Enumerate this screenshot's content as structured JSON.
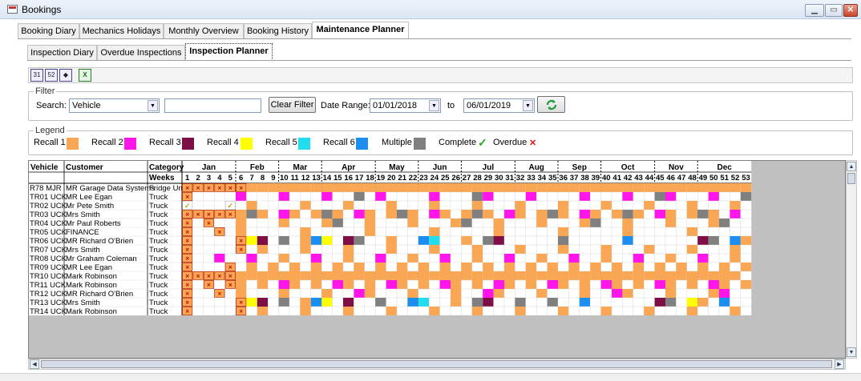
{
  "window": {
    "title": "Bookings",
    "icon": "app-window-icon"
  },
  "main_tabs": [
    {
      "label": "Booking Diary",
      "active": false
    },
    {
      "label": "Mechanics Holidays",
      "active": false
    },
    {
      "label": "Monthly Overview",
      "active": false
    },
    {
      "label": "Booking History",
      "active": false
    },
    {
      "label": "Maintenance Planner",
      "active": true
    }
  ],
  "sub_tabs": [
    {
      "label": "Inspection Diary",
      "active": false
    },
    {
      "label": "Overdue Inspections",
      "active": false
    },
    {
      "label": "Inspection Planner",
      "active": true
    }
  ],
  "toolbar": {
    "buttons": [
      {
        "label": "31",
        "icon": "day-view-icon"
      },
      {
        "label": "52",
        "icon": "week-view-icon"
      },
      {
        "label": "◆",
        "icon": "expand-icon"
      },
      {
        "label": "X",
        "icon": "excel-export-icon"
      }
    ]
  },
  "filter": {
    "group_label": "Filter",
    "search_label": "Search:",
    "search_select": "Vehicle",
    "search_text": "",
    "clear_button": "Clear Filter",
    "date_range_label": "Date Range:",
    "date_from": "01/01/2018",
    "to_label": "to",
    "date_to": "06/01/2019",
    "refresh_icon": "refresh-icon"
  },
  "legend": {
    "group_label": "Legend",
    "items": [
      {
        "label": "Recall 1",
        "color": "#f9a655"
      },
      {
        "label": "Recall 2",
        "color": "#ff14ea"
      },
      {
        "label": "Recall 3",
        "color": "#7e0f46"
      },
      {
        "label": "Recall 4",
        "color": "#ffff00"
      },
      {
        "label": "Recall 5",
        "color": "#22dcf0"
      },
      {
        "label": "Recall 6",
        "color": "#1c8ef0"
      },
      {
        "label": "Multiple",
        "color": "#808080"
      },
      {
        "label": "Complete",
        "icon": "check-icon",
        "color": "#2aa52a"
      },
      {
        "label": "Overdue",
        "icon": "cross-icon",
        "color": "#e01515"
      }
    ]
  },
  "planner": {
    "headers": {
      "vehicle": "Vehicle",
      "customer": "Customer",
      "category": "Category",
      "weeks": "Weeks"
    },
    "months": [
      {
        "label": "Jan",
        "weeks": 5
      },
      {
        "label": "Feb",
        "weeks": 4
      },
      {
        "label": "Mar",
        "weeks": 4
      },
      {
        "label": "Apr",
        "weeks": 5
      },
      {
        "label": "May",
        "weeks": 4
      },
      {
        "label": "Jun",
        "weeks": 4
      },
      {
        "label": "Jul",
        "weeks": 5
      },
      {
        "label": "Aug",
        "weeks": 4
      },
      {
        "label": "Sep",
        "weeks": 4
      },
      {
        "label": "Oct",
        "weeks": 5
      },
      {
        "label": "Nov",
        "weeks": 4
      },
      {
        "label": "Dec",
        "weeks": 5
      }
    ],
    "week_numbers": [
      "1",
      "2",
      "3",
      "4",
      "5",
      "6",
      "7",
      "8",
      "9",
      "10",
      "11",
      "12",
      "13",
      "14",
      "15",
      "16",
      "17",
      "18",
      "19",
      "20",
      "21",
      "22",
      "23",
      "24",
      "25",
      "26",
      "27",
      "28",
      "29",
      "30",
      "31",
      "32",
      "33",
      "34",
      "35",
      "36",
      "37",
      "38",
      "39",
      "40",
      "41",
      "42",
      "43",
      "44",
      "45",
      "46",
      "47",
      "48",
      "49",
      "50",
      "51",
      "52",
      "53"
    ],
    "rows": [
      {
        "vehicle": "R78 MJR",
        "customer": "MR Garage Data Systems",
        "category": "Fridge Unit",
        "cells": "XXXXXX11111111111111111111111111111111111111111111111"
      },
      {
        "vehicle": "TR01 UCK",
        "customer": "MR Lee Egan",
        "category": "Truck",
        "cells": "X....2...2...2..G.2....2...G2...2....2...2..G2...2..G"
      },
      {
        "vehicle": "TR02 UCK",
        "customer": "Mr Pete Smith",
        "category": "Truck",
        "cells": "C...C.1....1...1...1...1...1...1...1...1...1...1...1"
      },
      {
        "vehicle": "TR03 UCK",
        "customer": "Mrs Smith",
        "category": "Truck",
        "cells": "XXXXX1G1.21.1G1.21.1G1.21.1G1.21.1G1.21.1G1.21.1G1.2"
      },
      {
        "vehicle": "TR04 UCK",
        "customer": "Mr Paul Roberts",
        "category": "Truck",
        "cells": "X.X..1...1...1G..1...1...1G..1...1...1G..1...1...1G.."
      },
      {
        "vehicle": "TR05 UCK",
        "customer": "FINANCE",
        "category": "Truck",
        "cells": "X..X.1.....1.....1.....1.....1.....1.....1.....1...."
      },
      {
        "vehicle": "TR06 UCK",
        "customer": "MR Richard O'Brien",
        "category": "Truck",
        "cells": "X....XYM.G.1BY.MG..1..B6..1.G3.....G.....B......3G.B1"
      },
      {
        "vehicle": "TR07 UCK",
        "customer": "Mrs Smith",
        "category": "Truck",
        "cells": "X....X.1...1...1...1...1...1...1...1...1...1...1...1."
      },
      {
        "vehicle": "TR08 UCK",
        "customer": "Mr Graham Coleman",
        "category": "Truck",
        "cells": "X..2..2..1..2..1..2..1..2..1..2..1..2..1..2..1..2..1."
      },
      {
        "vehicle": "TR09 UCK",
        "customer": "MR Lee Egan",
        "category": "Truck",
        "cells": "X...X.1.1.1.1.1.1.1.1.1.1.1.1.1.1.1.1.1.1.1.1.1.1.1.1"
      },
      {
        "vehicle": "TR10 UCK",
        "customer": "Mark Robinson",
        "category": "Truck",
        "cells": "XXXXX11111111111111111111111111111111111111111111111"
      },
      {
        "vehicle": "TR11 UCK",
        "customer": "Mark Robinson",
        "category": "Truck",
        "cells": "X.X.X1.1.21.1.21.1.21.1.21.1.21.1.21.1.21.1.21.1.21.1"
      },
      {
        "vehicle": "TR12 UCK",
        "customer": "MR Richard O'Brien",
        "category": "Truck",
        "cells": "X..X.1...1...1..21...1...1..21...1...1..21...1...12.."
      },
      {
        "vehicle": "TR13 UCK",
        "customer": "Mrs Smith",
        "category": "Truck",
        "cells": "X....XYM.G.1BY.M..G..B6..1.G3..G..G..B......3G.Y1.B"
      },
      {
        "vehicle": "TR14 UCK",
        "customer": "Mark Robinson",
        "category": "Truck",
        "cells": "X....X.1...1...1...1...1...1...1...1...1...1...1...1."
      }
    ]
  }
}
